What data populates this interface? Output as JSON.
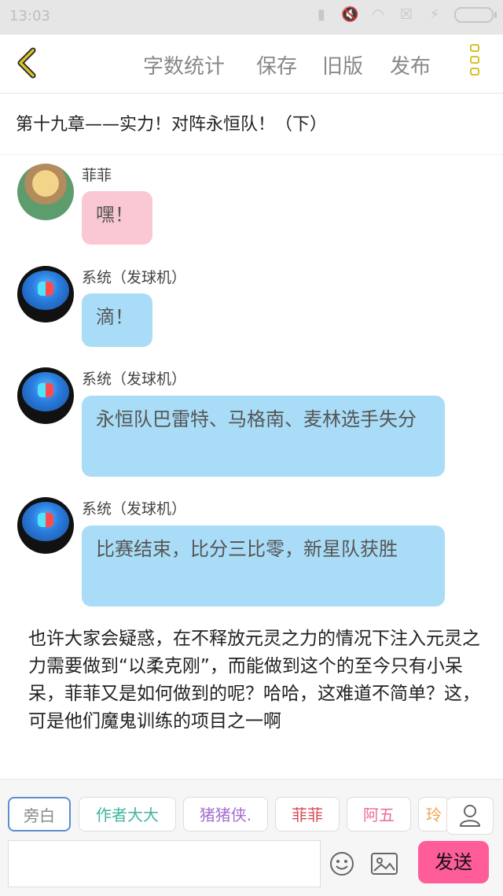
{
  "status_bar": {
    "time": "13:03"
  },
  "top_bar": {
    "menu": [
      {
        "label": "字数统计"
      },
      {
        "label": "保存"
      },
      {
        "label": "旧版"
      },
      {
        "label": "发布"
      }
    ]
  },
  "chapter_title": "第十九章——实力！对阵永恒队！（下）",
  "messages": [
    {
      "name": "菲菲",
      "text": "嘿！",
      "bubble_color": "#f9c8d2"
    },
    {
      "name": "系统（发球机）",
      "text": "滴！",
      "bubble_color": "#a9dcf7"
    },
    {
      "name": "系统（发球机）",
      "text": "永恒队巴雷特、马格南、麦林选手失分",
      "bubble_color": "#a9dcf7"
    },
    {
      "name": "系统（发球机）",
      "text": "比赛结束，比分三比零，新星队获胜",
      "bubble_color": "#a9dcf7"
    }
  ],
  "narration": "也许大家会疑惑，在不释放元灵之力的情况下注入元灵之力需要做到“以柔克刚”，而能做到这个的至今只有小呆呆，菲菲又是如何做到的呢？哈哈，这难道不简单？这，可是他们魔鬼训练的项目之一啊",
  "bottom_bar": {
    "tags": [
      {
        "label": "旁白",
        "color": "#8a8a8a"
      },
      {
        "label": "作者大大",
        "color": "#3fb3a0"
      },
      {
        "label": "猪猪侠.",
        "color": "#a56fd1"
      },
      {
        "label": "菲菲",
        "color": "#d64b55"
      },
      {
        "label": "阿五",
        "color": "#ea6b9a"
      },
      {
        "label": "玲",
        "color": "#f0a34b"
      }
    ],
    "input_placeholder": "",
    "send_label": "发送"
  },
  "colors": {
    "accent_pink": "#ff5c9a",
    "more_icon": "#d6c12a"
  }
}
